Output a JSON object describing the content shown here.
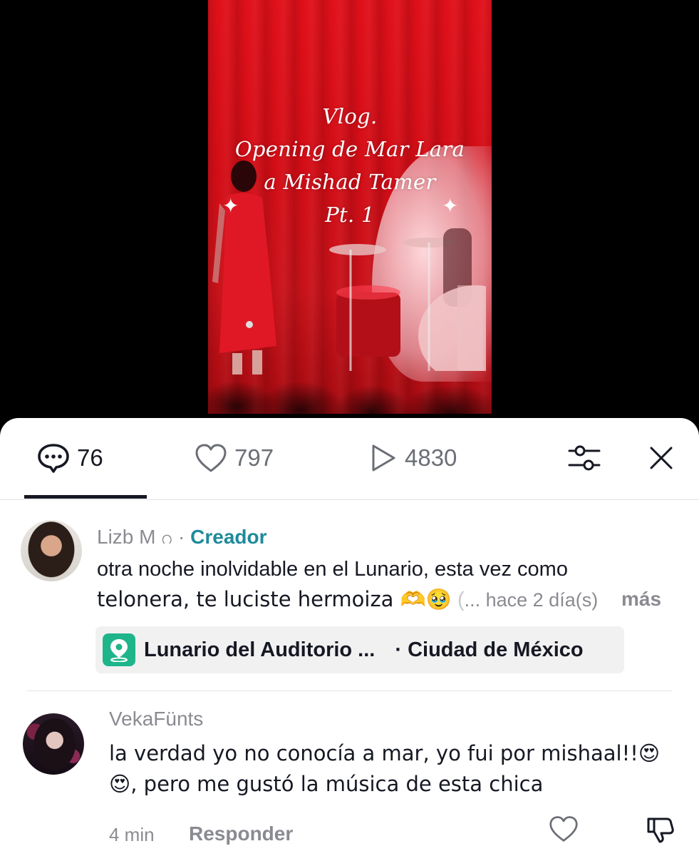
{
  "video": {
    "overlay_lines": [
      "Vlog.",
      "Opening de Mar Lara",
      "a Mishad Tamer",
      "Pt. 1"
    ]
  },
  "tabs": {
    "comments": {
      "count": "76",
      "icon": "comment-bubble-icon"
    },
    "likes": {
      "count": "797",
      "icon": "heart-outline-icon"
    },
    "plays": {
      "count": "4830",
      "icon": "play-icon"
    },
    "filter_icon": "sliders-icon",
    "close_icon": "close-x-icon"
  },
  "comments": [
    {
      "author": "Lizb M ဂ",
      "separator": "·",
      "badge": "Creador",
      "text_line1": "otra noche inolvidable en el Lunario, esta vez como",
      "text_line2": "telonera, te luciste hermoiza 🫶🥹",
      "truncation": " (",
      "meta": "... hace 2 día(s)",
      "more_label": "más",
      "location": {
        "icon": "location-pin-icon",
        "name": "Lunario del Auditorio ...",
        "city": "· Ciudad de México"
      }
    },
    {
      "author": "VekaFünts",
      "text_line1": "la verdad yo no conocía a mar, yo fui por mishaal!!😍",
      "text_line2": "😍, pero me gustó la música de esta chica",
      "time": "4 min",
      "reply_label": "Responder",
      "like_icon": "heart-outline-icon",
      "dislike_icon": "thumbs-down-icon"
    }
  ]
}
